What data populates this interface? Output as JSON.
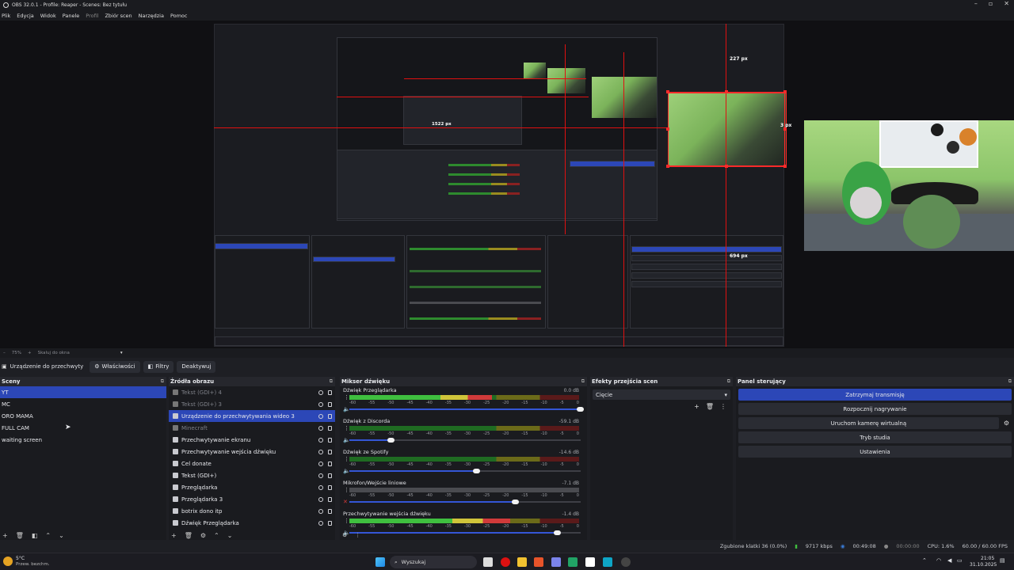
{
  "window": {
    "title": "OBS 32.0.1 - Profile: Reaper - Scenes: Bez tytułu"
  },
  "menu": [
    "Plik",
    "Edycja",
    "Widok",
    "Panele",
    "Profil",
    "Zbiór scen",
    "Narzędzia",
    "Pomoc"
  ],
  "preview": {
    "labels": {
      "px227": "227 px",
      "px1522": "1522 px",
      "px694": "694 px",
      "px3": "3 px"
    }
  },
  "zoom": {
    "value": "75%",
    "fit": "Skaluj do okna"
  },
  "context_bar": {
    "source": "Urządzenie do przechwyty",
    "properties": "Właściwości",
    "filters": "Filtry",
    "deactivate": "Deaktywuj"
  },
  "scenes": {
    "title": "Sceny",
    "items": [
      {
        "label": "YT",
        "selected": true
      },
      {
        "label": "MC"
      },
      {
        "label": "ORO MAMA"
      },
      {
        "label": "FULL CAM"
      },
      {
        "label": "waiting screen"
      }
    ]
  },
  "sources": {
    "title": "Źródła obrazu",
    "items": [
      {
        "label": "Tekst (GDI+) 4",
        "dim": true
      },
      {
        "label": "Tekst (GDI+) 3",
        "dim": true
      },
      {
        "label": "Urządzenie do przechwytywania wideo 3",
        "selected": true
      },
      {
        "label": "Minecraft",
        "dim": true
      },
      {
        "label": "Przechwytywanie ekranu"
      },
      {
        "label": "Przechwytywanie wejścia dźwięku"
      },
      {
        "label": "Cel donate"
      },
      {
        "label": "Tekst (GDI+)"
      },
      {
        "label": "Przeglądarka"
      },
      {
        "label": "Przeglądarka 3"
      },
      {
        "label": "botrix dono itp"
      },
      {
        "label": "Dźwięk Przeglądarka"
      }
    ]
  },
  "mixer": {
    "title": "Mikser dźwięku",
    "ticks": [
      "-60",
      "-55",
      "-50",
      "-45",
      "-40",
      "-35",
      "-30",
      "-25",
      "-20",
      "-15",
      "-10",
      "-5",
      "0"
    ],
    "channels": [
      {
        "name": "Dźwięk Przeglądarka",
        "db": "0.0 dB",
        "level": 0.62,
        "volume": 1.0,
        "muted": false
      },
      {
        "name": "Dźwięk z Discorda",
        "db": "-59.1 dB",
        "level": 0,
        "volume": 0.18,
        "muted": false
      },
      {
        "name": "Dźwięk ze Spotify",
        "db": "-14.6 dB",
        "level": 0,
        "volume": 0.55,
        "muted": false
      },
      {
        "name": "Mikrofon/Wejście liniowe",
        "db": "-7.1 dB",
        "level": 0,
        "volume": 0.72,
        "muted": true
      },
      {
        "name": "Przechwytywanie wejścia dźwięku",
        "db": "-1.4 dB",
        "level": 0.7,
        "volume": 0.9,
        "muted": false
      }
    ]
  },
  "transitions": {
    "title": "Efekty przejścia scen",
    "selected": "Cięcie"
  },
  "controls": {
    "title": "Panel sterujący",
    "buttons": [
      "Zatrzymaj transmisję",
      "Rozpocznij nagrywanie",
      "Uruchom kamerę wirtualną",
      "Tryb studia",
      "Ustawienia"
    ]
  },
  "status": {
    "dropped": "Zgubione klatki 36 (0.0%)",
    "bitrate": "9717 kbps",
    "stream_time": "00:49:08",
    "rec_time": "00:00:00",
    "cpu": "CPU: 1.6%",
    "fps": "60.00 / 60.00 FPS"
  },
  "taskbar": {
    "weather_temp": "5°C",
    "weather_desc": "Przew. bezchm.",
    "search": "Wyszukaj",
    "time": "21:05",
    "date": "31.10.2025"
  }
}
